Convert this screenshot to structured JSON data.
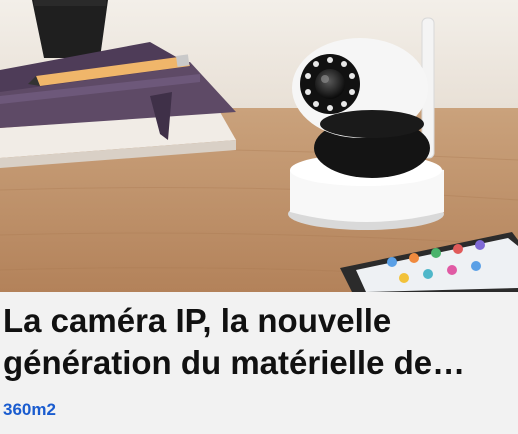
{
  "card": {
    "image": {
      "subject": "IP camera on wooden table with phone and books",
      "icon": "camera-photo"
    },
    "title": "La caméra IP, la nouvelle génération du matérielle de…",
    "source": "360m2",
    "colors": {
      "background": "#f2f2f2",
      "title": "#111111",
      "source": "#1a5ccf"
    }
  }
}
